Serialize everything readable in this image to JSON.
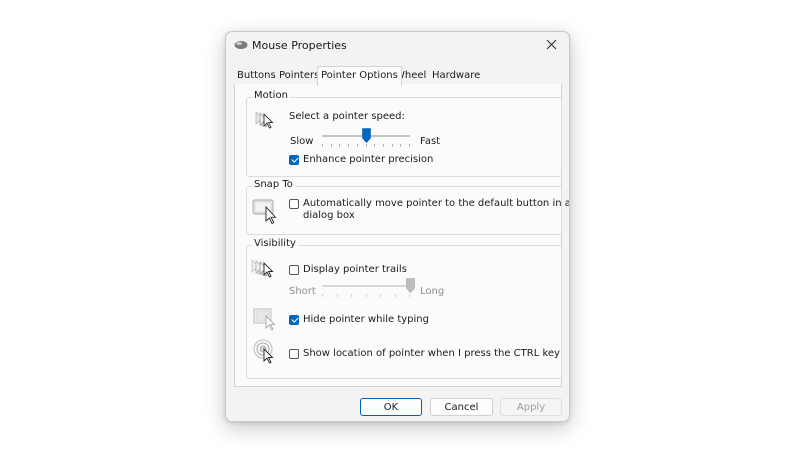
{
  "window": {
    "title": "Mouse Properties",
    "title_icon": "mouse-icon",
    "close_icon": "close-icon"
  },
  "tabs": [
    {
      "label": "Buttons",
      "active": false
    },
    {
      "label": "Pointers",
      "active": false
    },
    {
      "label": "Pointer Options",
      "active": true
    },
    {
      "label": "Wheel",
      "active": false
    },
    {
      "label": "Hardware",
      "active": false
    }
  ],
  "motion": {
    "group_label": "Motion",
    "speed_label": "Select a pointer speed:",
    "slow_label": "Slow",
    "fast_label": "Fast",
    "speed_fraction": 0.5,
    "precision_label": "Enhance pointer precision",
    "precision_checked": true
  },
  "snap": {
    "group_label": "Snap To",
    "snap_label_line1": "Automatically move pointer to the default button in a",
    "snap_label_line2": "dialog box",
    "snap_checked": false
  },
  "visibility": {
    "group_label": "Visibility",
    "trails_label": "Display pointer trails",
    "trails_checked": false,
    "short_label": "Short",
    "long_label": "Long",
    "trail_fraction": 1.0,
    "hide_label": "Hide pointer while typing",
    "hide_checked": true,
    "show_location_label": "Show location of pointer when I press the CTRL key",
    "show_location_checked": false
  },
  "buttons": {
    "ok": "OK",
    "cancel": "Cancel",
    "apply": "Apply"
  },
  "colors": {
    "accent": "#0067c0",
    "dialog_bg": "#f3f3f3",
    "panel_bg": "#fbfbfb"
  }
}
